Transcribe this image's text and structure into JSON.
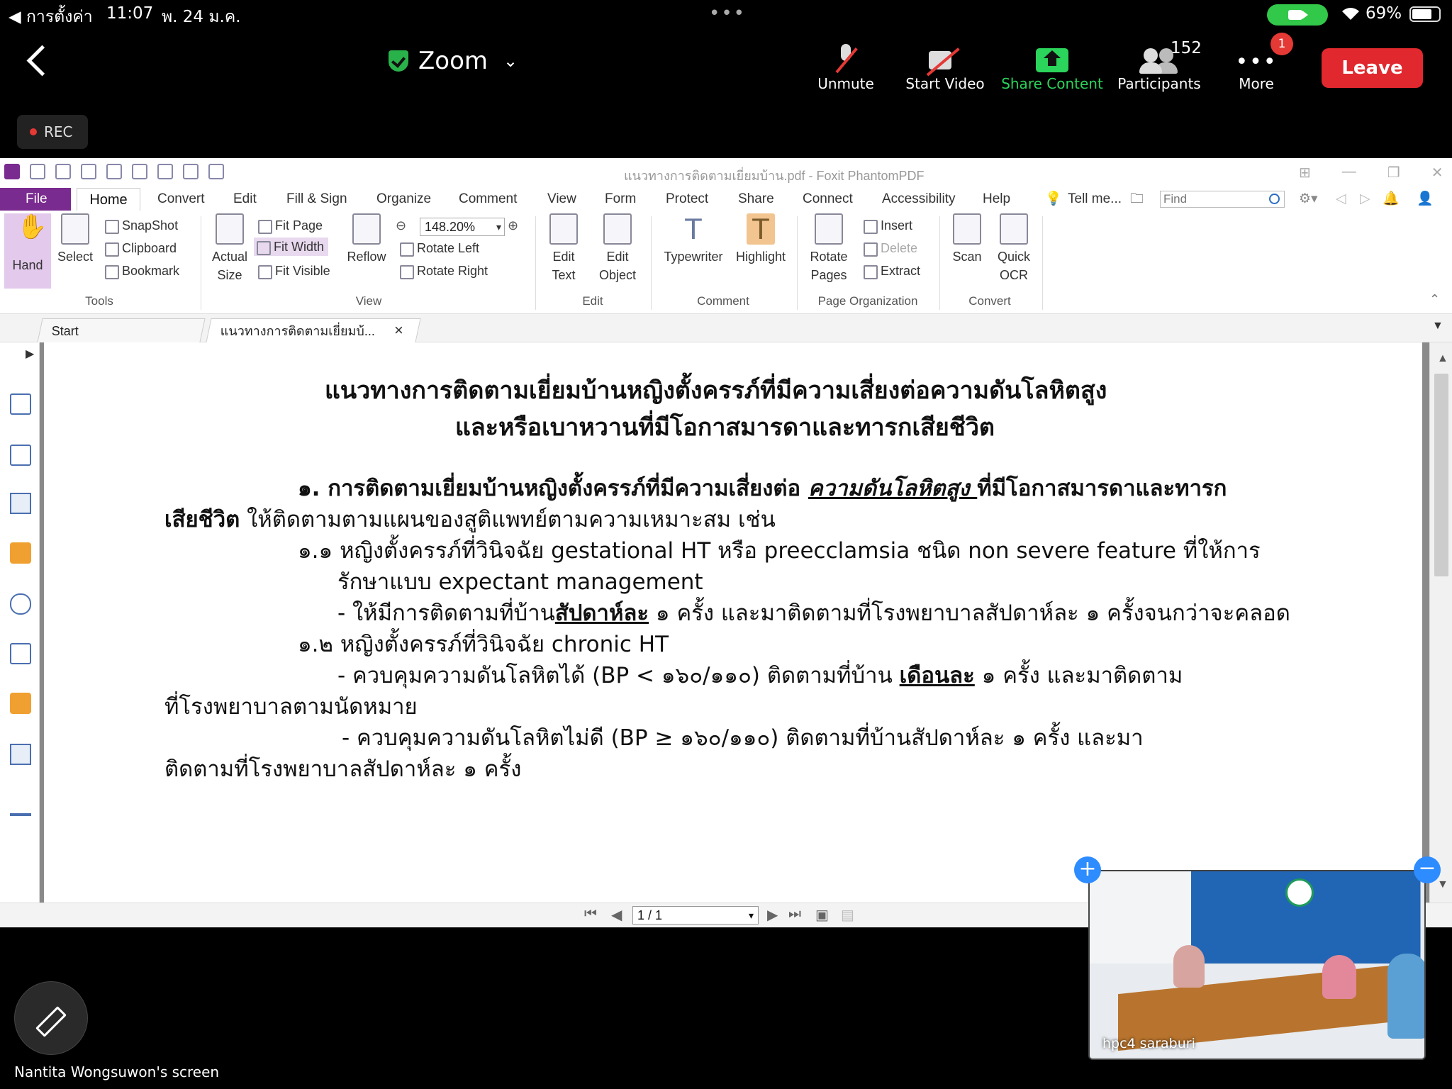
{
  "status_bar": {
    "back_label": "◀ การตั้งค่า",
    "time": "11:07",
    "date": "พ. 24 ม.ค.",
    "battery": "69%"
  },
  "zoom": {
    "title": "Zoom",
    "unmute": "Unmute",
    "start_video": "Start Video",
    "share_content": "Share Content",
    "participants": "Participants",
    "participant_count": "152",
    "more": "More",
    "more_badge": "1",
    "leave": "Leave",
    "rec": "REC",
    "screen_owner": "Nantita Wongsuwon's screen",
    "video_name": "hpc4 saraburi",
    "share_accent": "#2bd45a",
    "leave_color": "#e0282e"
  },
  "foxit": {
    "window_title": "แนวทางการติดตามเยี่ยมบ้าน.pdf - Foxit PhantomPDF",
    "tabs": {
      "file": "File",
      "home": "Home",
      "convert": "Convert",
      "edit": "Edit",
      "fill_sign": "Fill & Sign",
      "organize": "Organize",
      "comment": "Comment",
      "view": "View",
      "form": "Form",
      "protect": "Protect",
      "share": "Share",
      "connect": "Connect",
      "accessibility": "Accessibility",
      "help": "Help",
      "tell_me": "Tell me..."
    },
    "find_placeholder": "Find",
    "ribbon": {
      "hand": "Hand",
      "select": "Select",
      "snapshot": "SnapShot",
      "clipboard": "Clipboard",
      "bookmark": "Bookmark",
      "tools_group": "Tools",
      "actual_size_1": "Actual",
      "actual_size_2": "Size",
      "fit_page": "Fit Page",
      "fit_width": "Fit Width",
      "fit_visible": "Fit Visible",
      "reflow": "Reflow",
      "zoom_value": "148.20%",
      "rotate_left": "Rotate Left",
      "rotate_right": "Rotate Right",
      "view_group": "View",
      "edit_text_1": "Edit",
      "edit_text_2": "Text",
      "edit_object_1": "Edit",
      "edit_object_2": "Object",
      "edit_group": "Edit",
      "typewriter": "Typewriter",
      "highlight": "Highlight",
      "comment_group": "Comment",
      "rotate_pages_1": "Rotate",
      "rotate_pages_2": "Pages",
      "insert": "Insert",
      "delete": "Delete",
      "extract": "Extract",
      "page_org_group": "Page Organization",
      "scan": "Scan",
      "quick_ocr_1": "Quick",
      "quick_ocr_2": "OCR",
      "convert_group": "Convert"
    },
    "doc_tabs": {
      "start": "Start",
      "doc": "แนวทางการติดตามเยี่ยมบ้...",
      "close": "×"
    },
    "page_indicator": "1 / 1",
    "accent": "#7a2b8f"
  },
  "document": {
    "title_line1": "แนวทางการติดตามเยี่ยมบ้านหญิงตั้งครรภ์ที่มีความเสี่ยงต่อความดันโลหิตสูง",
    "title_line2": "และหรือเบาหวานที่มีโอกาสมารดาและทารกเสียชีวิต",
    "s1_a": "๑. การติดตามเยี่ยมบ้านหญิงตั้งครรภ์ที่มีความเสี่ยงต่อ ",
    "s1_b": "ความดันโลหิตสูง ",
    "s1_c": "ที่มีโอกาสมารดาและทารก",
    "s1_d": "เสียชีวิต",
    "s1_e": " ให้ติดตามตามแผนของสูติแพทย์ตามความเหมาะสม เช่น",
    "s11_a": "๑.๑  หญิงตั้งครรภ์ที่วินิจฉัย gestational HT หรือ preecclamsia ชนิด non severe feature ที่ให้การ",
    "s11_b": "รักษาแบบ expectant management",
    "s11_c1": "- ให้มีการติดตามที่บ้าน",
    "s11_c2": "สัปดาห์ละ",
    "s11_c3": " ๑ ครั้ง และมาติดตามที่โรงพยาบาลสัปดาห์ละ ๑ ครั้งจนกว่าจะคลอด",
    "s12_a": "๑.๒  หญิงตั้งครรภ์ที่วินิจฉัย chronic HT",
    "s12_b1": "- ควบคุมความดันโลหิตได้ (BP < ๑๖๐/๑๑๐) ติดตามที่บ้าน ",
    "s12_b2": "เดือนละ",
    "s12_b3": " ๑ ครั้ง และมาติดตาม",
    "s12_c": "ที่โรงพยาบาลตามนัดหมาย",
    "s12_d": "- ควบคุมความดันโลหิตไม่ดี (BP ≥ ๑๖๐/๑๑๐) ติดตามที่บ้านสัปดาห์ละ ๑ ครั้ง และมา",
    "s12_e": "ติดตามที่โรงพยาบาลสัปดาห์ละ ๑ ครั้ง"
  }
}
